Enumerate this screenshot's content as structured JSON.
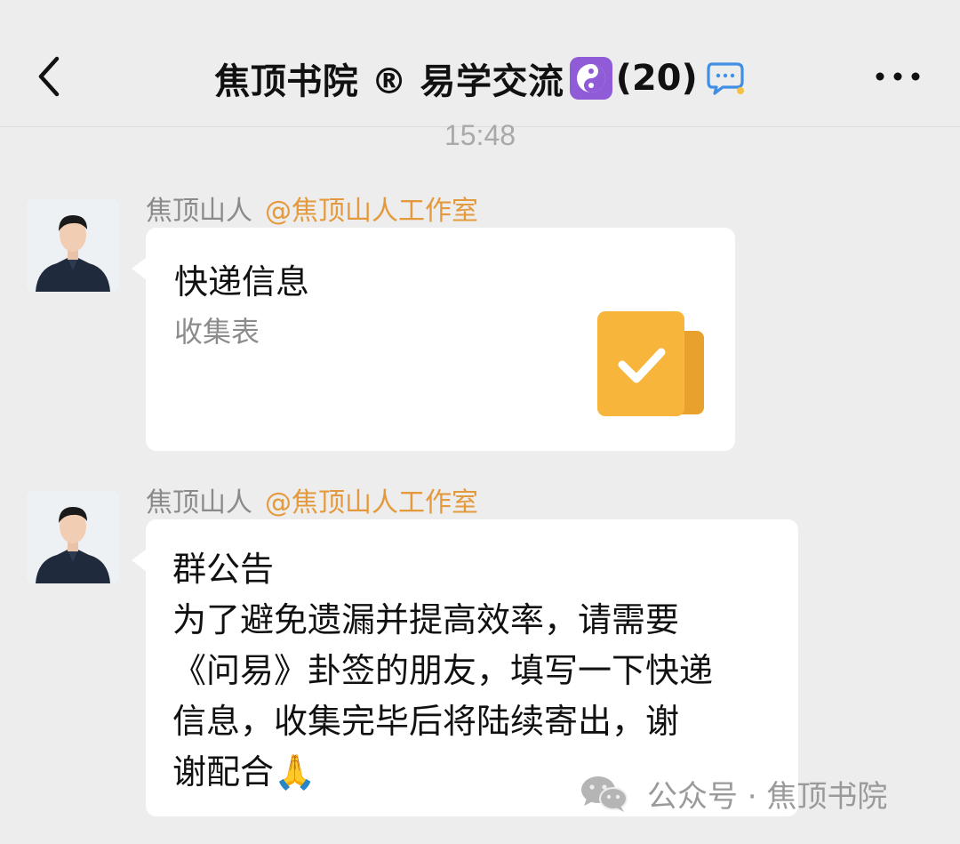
{
  "header": {
    "title": "焦顶书院 ® 易学交流",
    "title_emoji": "☯️",
    "member_count": "(20)"
  },
  "timestamp": "15:48",
  "messages": [
    {
      "sender": "焦顶山人",
      "mention": "@焦顶山人工作室",
      "card": {
        "title": "快递信息",
        "subtitle": "收集表",
        "icon": "checklist-form-icon",
        "icon_color": "#f7b53b"
      }
    },
    {
      "sender": "焦顶山人",
      "mention": "@焦顶山人工作室",
      "text_lines": [
        "群公告",
        "为了避免遗漏并提高效率，请需要",
        "《问易》卦签的朋友，填写一下快递",
        "信息，收集完毕后将陆续寄出，谢",
        "谢配合"
      ],
      "emoji": "🙏"
    }
  ],
  "watermark": {
    "text": "公众号 · 焦顶书院",
    "icon": "wechat-icon"
  },
  "colors": {
    "background": "#ededed",
    "bubble": "#ffffff",
    "mention": "#e49a3c",
    "sender_name": "#8a8a8a",
    "timestamp": "#a9a9a9"
  }
}
